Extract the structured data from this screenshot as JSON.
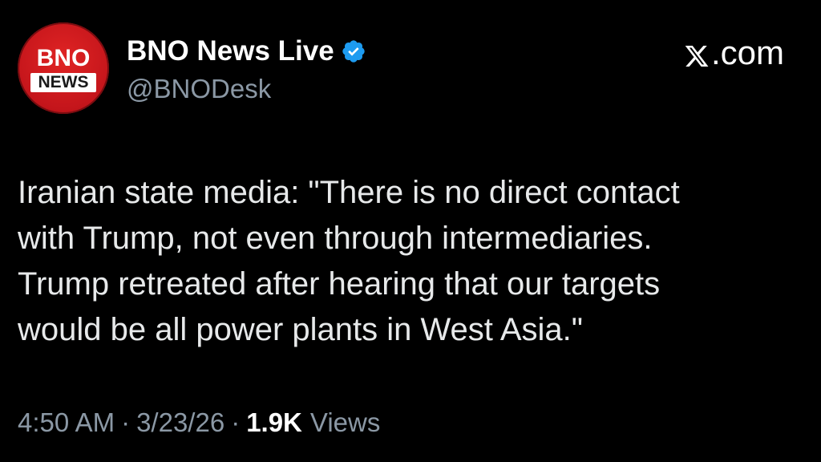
{
  "account": {
    "display_name": "BNO News Live",
    "handle": "@BNODesk",
    "verified": true,
    "avatar_logo_top": "BNO",
    "avatar_logo_bottom": "NEWS"
  },
  "brand": {
    "label": ".com",
    "icon": "x-logo-icon"
  },
  "tweet": {
    "text_lines": [
      "Iranian state media: \"There is no direct contact",
      "with Trump, not even through intermediaries.",
      "Trump retreated after hearing that our targets",
      "would be all power plants in West Asia.\""
    ]
  },
  "meta": {
    "time": "4:50 AM",
    "separator": "·",
    "date": "3/23/26",
    "views_count": "1.9K",
    "views_label": "Views"
  },
  "colors": {
    "background": "#000000",
    "primary_text": "#e7e9ea",
    "secondary_text": "#8b98a5",
    "verified_blue": "#1d9bf0",
    "avatar_red": "#d61f26"
  }
}
